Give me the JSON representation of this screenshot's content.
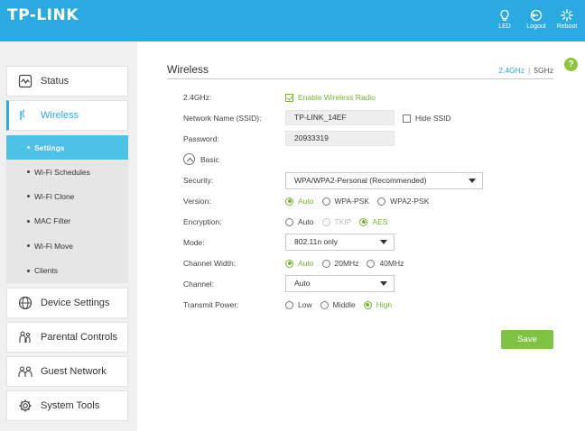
{
  "header": {
    "brand": "TP-LINK",
    "buttons": {
      "led": "LED",
      "logout": "Logout",
      "reboot": "Reboot"
    }
  },
  "sidebar": {
    "items": [
      {
        "label": "Status",
        "icon": "status-icon"
      },
      {
        "label": "Wireless",
        "icon": "wireless-icon"
      },
      {
        "label": "Device Settings",
        "icon": "globe-icon"
      },
      {
        "label": "Parental Controls",
        "icon": "family-icon"
      },
      {
        "label": "Guest Network",
        "icon": "guest-icon"
      },
      {
        "label": "System Tools",
        "icon": "gear-icon"
      }
    ],
    "subitems": [
      "Settings",
      "Wi-Fi Schedules",
      "Wi-Fi Clone",
      "MAC Filter",
      "Wi-Fi Move",
      "Clients"
    ]
  },
  "main": {
    "title": "Wireless",
    "band_24": "2.4GHz",
    "band_sep": "|",
    "band_5": "5GHz",
    "help": "?",
    "form": {
      "band_label": "2.4GHz:",
      "enable_radio_label": "Enable Wireless Radio",
      "enable_radio_checked": true,
      "ssid_label": "Network Name (SSID):",
      "ssid_value": "TP-LINK_14EF",
      "hide_ssid_label": "Hide SSID",
      "hide_ssid_checked": false,
      "password_label": "Password:",
      "password_value": "20933319",
      "basic_label": "Basic",
      "security_label": "Security:",
      "security_value": "WPA/WPA2-Personal (Recommended)",
      "version_label": "Version:",
      "version_options": [
        "Auto",
        "WPA-PSK",
        "WPA2-PSK"
      ],
      "version_selected": "Auto",
      "encryption_label": "Encryption:",
      "encryption_options": [
        "Auto",
        "TKIP",
        "AES"
      ],
      "encryption_selected": "AES",
      "mode_label": "Mode:",
      "mode_value": "802.11n only",
      "channel_width_label": "Channel Width:",
      "channel_width_options": [
        "Auto",
        "20MHz",
        "40MHz"
      ],
      "channel_width_selected": "Auto",
      "channel_label": "Channel:",
      "channel_value": "Auto",
      "transmit_power_label": "Transmit Power:",
      "transmit_power_options": [
        "Low",
        "Middle",
        "High"
      ],
      "transmit_power_selected": "High",
      "save_label": "Save"
    }
  },
  "colors": {
    "header": "#2baae1",
    "accent": "#2baae1",
    "active_sub": "#4cc2e6",
    "green": "#7ab32e",
    "save": "#7ec342"
  }
}
